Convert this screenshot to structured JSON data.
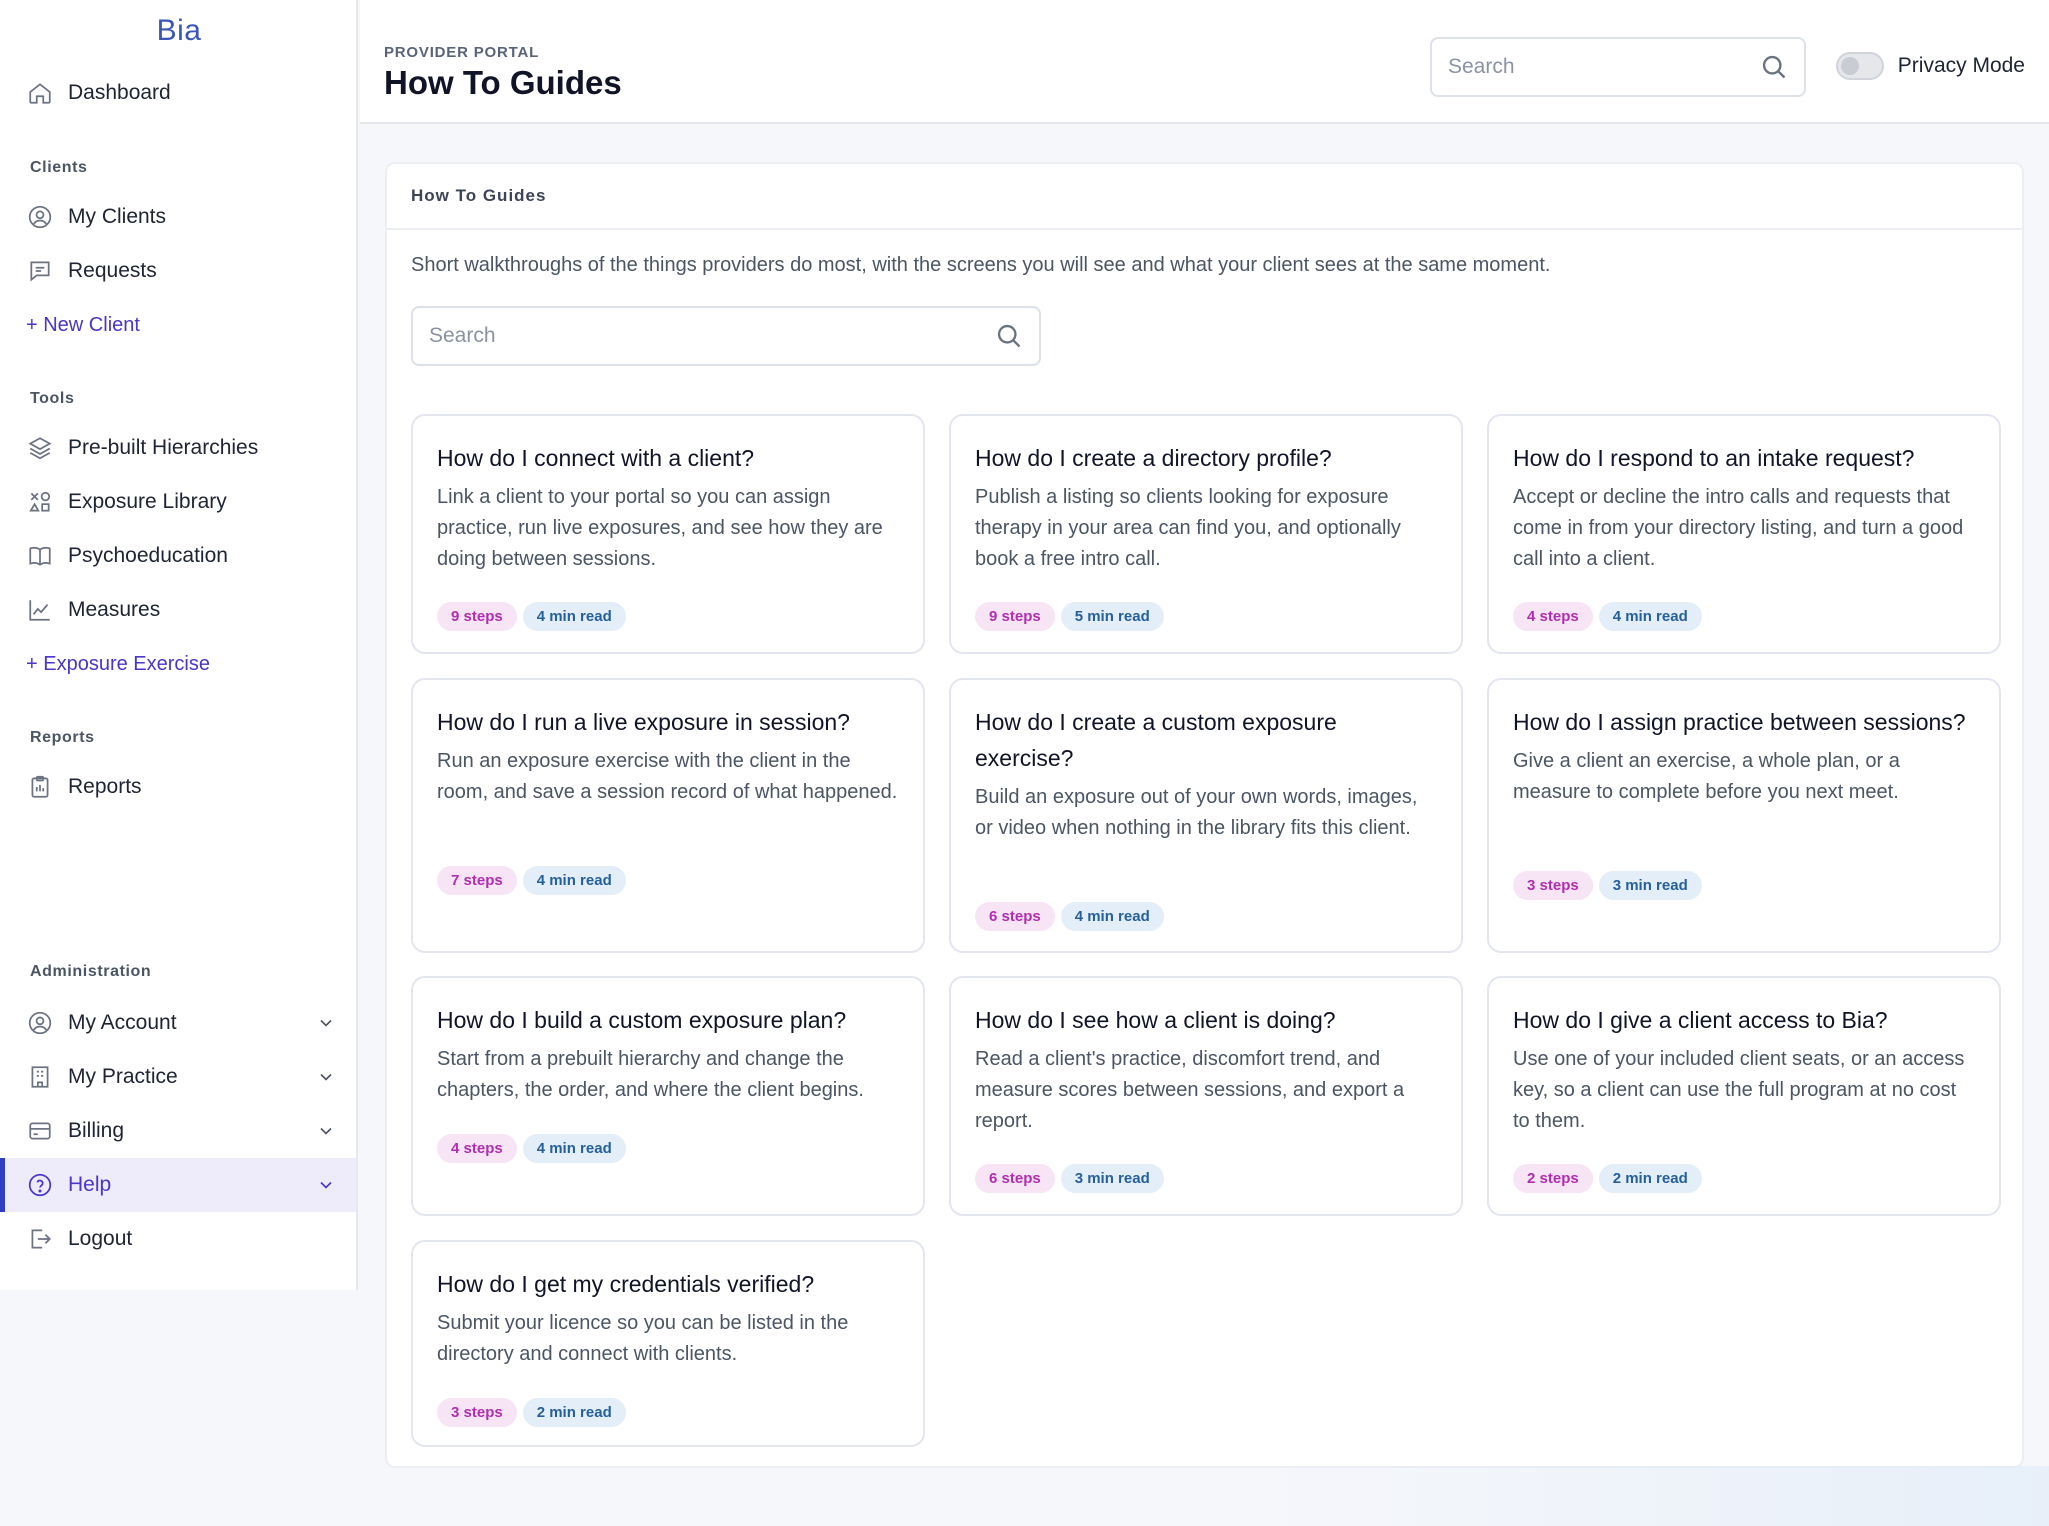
{
  "brand": "Bia",
  "sidebar": {
    "dashboard": "Dashboard",
    "sections": {
      "clients": "Clients",
      "tools": "Tools",
      "reports": "Reports",
      "administration": "Administration"
    },
    "clients_items": [
      "My Clients",
      "Requests"
    ],
    "new_client": "+ New Client",
    "tools_items": [
      "Pre-built Hierarchies",
      "Exposure Library",
      "Psychoeducation",
      "Measures"
    ],
    "exposure_exercise": "+ Exposure Exercise",
    "reports_items": [
      "Reports"
    ],
    "admin_items": [
      "My Account",
      "My Practice",
      "Billing",
      "Help"
    ],
    "logout": "Logout",
    "active": "Help"
  },
  "header": {
    "eyebrow": "PROVIDER PORTAL",
    "title": "How To Guides",
    "search_placeholder": "Search",
    "privacy_label": "Privacy Mode",
    "privacy_on": false
  },
  "panel": {
    "heading": "How To Guides",
    "description": "Short walkthroughs of the things providers do most, with the screens you will see and what your client sees at the same moment.",
    "search_placeholder": "Search"
  },
  "guides": [
    {
      "title": "How do I connect with a client?",
      "desc": "Link a client to your portal so you can assign practice, run live exposures, and see how they are doing between sessions.",
      "steps": "9 steps",
      "read": "4 min read"
    },
    {
      "title": "How do I create a directory profile?",
      "desc": "Publish a listing so clients looking for exposure therapy in your area can find you, and optionally book a free intro call.",
      "steps": "9 steps",
      "read": "5 min read"
    },
    {
      "title": "How do I respond to an intake request?",
      "desc": "Accept or decline the intro calls and requests that come in from your directory listing, and turn a good call into a client.",
      "steps": "4 steps",
      "read": "4 min read"
    },
    {
      "title": "How do I run a live exposure in session?",
      "desc": "Run an exposure exercise with the client in the room, and save a session record of what happened.",
      "steps": "7 steps",
      "read": "4 min read"
    },
    {
      "title": "How do I create a custom exposure exercise?",
      "desc": "Build an exposure out of your own words, images, or video when nothing in the library fits this client.",
      "steps": "6 steps",
      "read": "4 min read"
    },
    {
      "title": "How do I assign practice between sessions?",
      "desc": "Give a client an exercise, a whole plan, or a measure to complete before you next meet.",
      "steps": "3 steps",
      "read": "3 min read"
    },
    {
      "title": "How do I build a custom exposure plan?",
      "desc": "Start from a prebuilt hierarchy and change the chapters, the order, and where the client begins.",
      "steps": "4 steps",
      "read": "4 min read"
    },
    {
      "title": "How do I see how a client is doing?",
      "desc": "Read a client's practice, discomfort trend, and measure scores between sessions, and export a report.",
      "steps": "6 steps",
      "read": "3 min read"
    },
    {
      "title": "How do I give a client access to Bia?",
      "desc": "Use one of your included client seats, or an access key, so a client can use the full program at no cost to them.",
      "steps": "2 steps",
      "read": "2 min read"
    },
    {
      "title": "How do I get my credentials verified?",
      "desc": "Submit your licence so you can be listed in the directory and connect with clients.",
      "steps": "3 steps",
      "read": "2 min read"
    }
  ],
  "colors": {
    "accent": "#4a36c8",
    "brand": "#3a57b8",
    "steps_badge_bg": "#f7e4f5",
    "steps_badge_text": "#b02fae",
    "read_badge_bg": "#e3eef8",
    "read_badge_text": "#26609c"
  },
  "icons": {
    "dashboard": "home-icon",
    "my_clients": "user-circle-icon",
    "requests": "message-icon",
    "pre_built": "layers-icon",
    "exposure_library": "shapes-icon",
    "psychoeducation": "book-icon",
    "measures": "chart-line-icon",
    "reports": "clipboard-icon",
    "my_account": "user-circle-icon",
    "my_practice": "building-icon",
    "billing": "card-icon",
    "help": "help-circle-icon",
    "logout": "logout-icon"
  }
}
